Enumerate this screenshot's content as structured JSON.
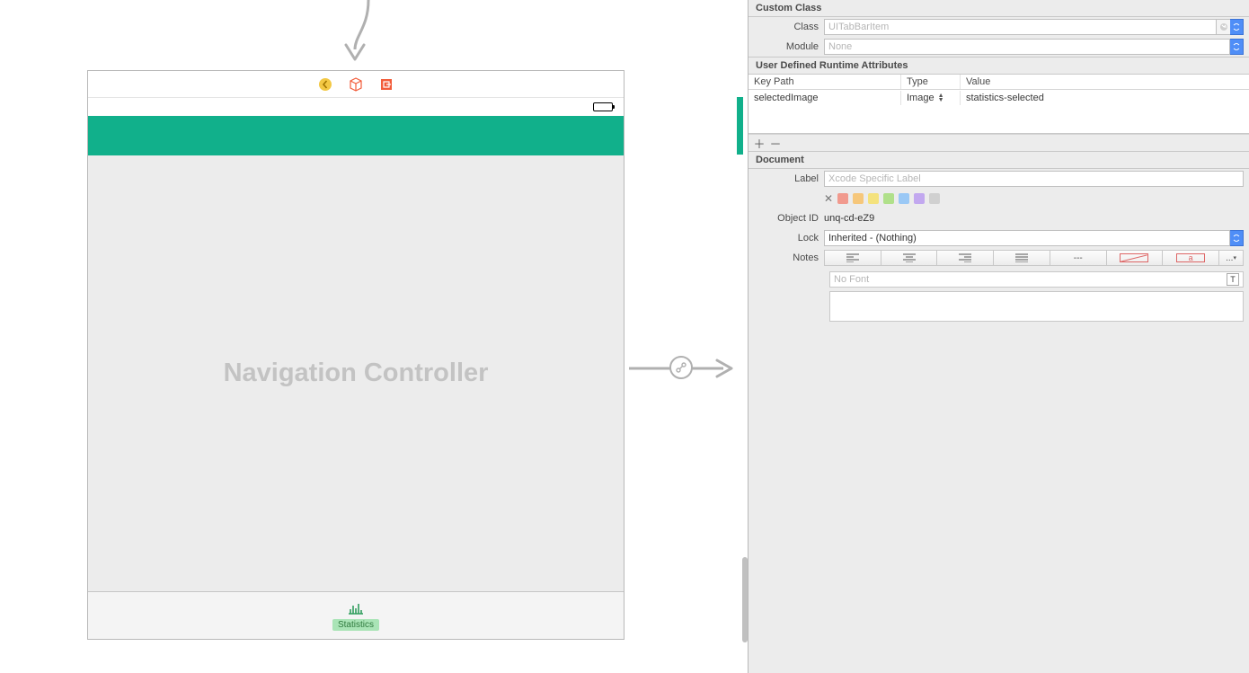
{
  "canvas": {
    "scene_title": "Navigation Controller",
    "tab_item_label": "Statistics"
  },
  "inspector": {
    "custom_class": {
      "header": "Custom Class",
      "class_label": "Class",
      "class_placeholder": "UITabBarItem",
      "module_label": "Module",
      "module_placeholder": "None"
    },
    "runtime_attrs": {
      "header": "User Defined Runtime Attributes",
      "cols": {
        "keypath": "Key Path",
        "type": "Type",
        "value": "Value"
      },
      "rows": [
        {
          "keypath": "selectedImage",
          "type": "Image",
          "value": "statistics-selected"
        }
      ]
    },
    "document": {
      "header": "Document",
      "label_label": "Label",
      "label_placeholder": "Xcode Specific Label",
      "objectid_label": "Object ID",
      "objectid_value": "unq-cd-eZ9",
      "lock_label": "Lock",
      "lock_value": "Inherited - (Nothing)",
      "notes_label": "Notes",
      "font_placeholder": "No Font",
      "more_label": "..."
    }
  }
}
